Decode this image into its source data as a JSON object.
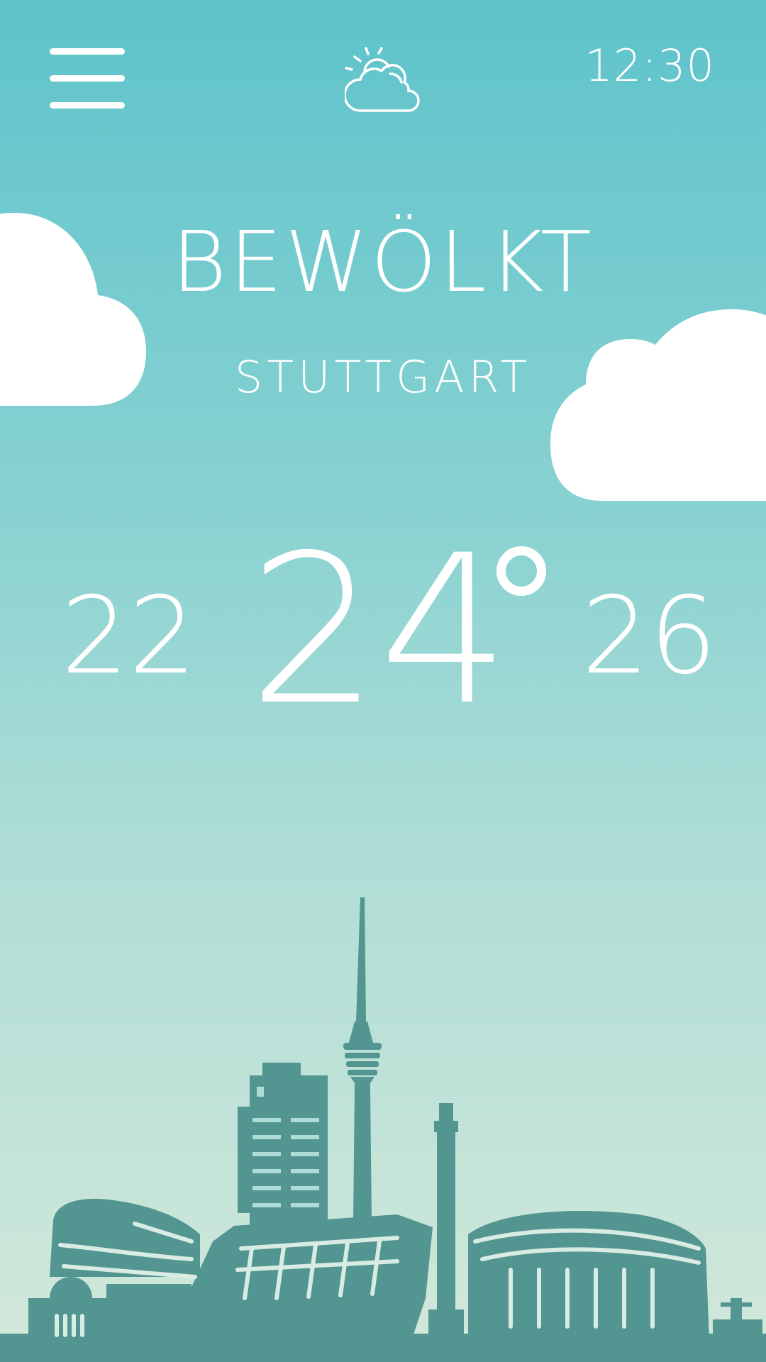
{
  "header": {
    "menu_icon": "hamburger-menu-icon",
    "weather_icon": "partly-cloudy-icon",
    "time": "12:30"
  },
  "weather": {
    "condition": "BEWÖLKT",
    "city": "STUTTGART",
    "temp_low": "22",
    "temp_current": "24",
    "temp_high": "26"
  },
  "colors": {
    "sky_top": "#5EC3CB",
    "sky_bottom": "#D2E8DA",
    "skyline": "#539590",
    "text": "#FFFFFF"
  }
}
